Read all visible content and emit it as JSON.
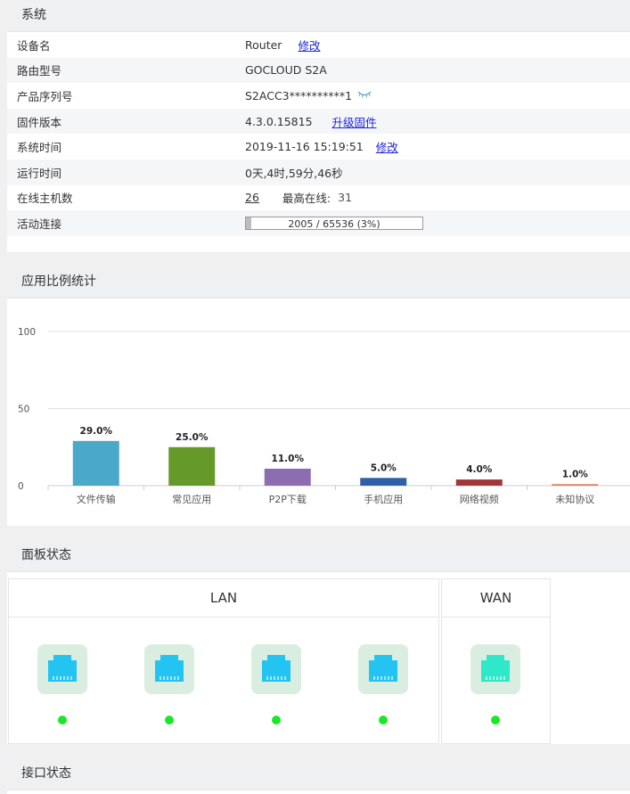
{
  "system": {
    "title": "系统",
    "rows": [
      {
        "key": "设备名",
        "value": "Router",
        "link": "修改"
      },
      {
        "key": "路由型号",
        "value": "GOCLOUD S2A"
      },
      {
        "key": "产品序列号",
        "value": "S2ACC3**********1",
        "icon": "eye-closed-icon"
      },
      {
        "key": "固件版本",
        "value": "4.3.0.15815",
        "link": "升级固件"
      },
      {
        "key": "系统时间",
        "value": "2019-11-16 15:19:51",
        "link": "修改"
      },
      {
        "key": "运行时间",
        "value": "0天,4时,59分,46秒"
      },
      {
        "key": "在线主机数",
        "value": "26",
        "extra_label": "最高在线:",
        "extra_value": "31"
      },
      {
        "key": "活动连接",
        "progress_text": "2005 / 65536 (3%)",
        "progress_fraction": 0.03
      }
    ]
  },
  "app_stats": {
    "title": "应用比例统计",
    "chart_data": {
      "type": "bar",
      "categories": [
        "文件传输",
        "常见应用",
        "P2P下载",
        "手机应用",
        "网络视频",
        "未知协议"
      ],
      "values": [
        29.0,
        25.0,
        11.0,
        5.0,
        4.0,
        1.0
      ],
      "data_labels": [
        "29.0%",
        "25.0%",
        "11.0%",
        "5.0%",
        "4.0%",
        "1.0%"
      ],
      "colors": [
        "#4aa8c8",
        "#65992a",
        "#8d6db1",
        "#2f5fa7",
        "#a0363a",
        "#d9825b"
      ],
      "ylim": [
        0,
        100
      ],
      "yticks": [
        "0",
        "50",
        "100"
      ],
      "grid": true
    }
  },
  "panel_status": {
    "title": "面板状态",
    "lan_title": "LAN",
    "wan_title": "WAN",
    "lan_ports": [
      {
        "color": "#23c4f2",
        "status": "up"
      },
      {
        "color": "#23c4f2",
        "status": "up"
      },
      {
        "color": "#23c4f2",
        "status": "up"
      },
      {
        "color": "#23c4f2",
        "status": "up"
      }
    ],
    "wan_port": {
      "color": "#2ee8c9",
      "status": "up"
    },
    "status_color": "#19e826"
  },
  "interface_status": {
    "title": "接口状态"
  }
}
